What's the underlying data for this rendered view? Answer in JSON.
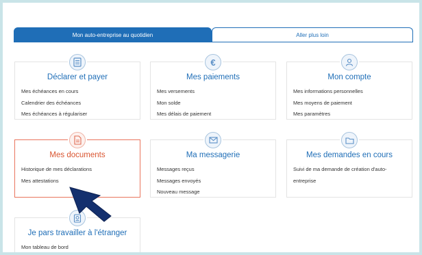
{
  "tabs": [
    {
      "label": "Mon auto-entreprise au quotidien",
      "active": true
    },
    {
      "label": "Aller plus loin",
      "active": false
    }
  ],
  "cards": [
    {
      "title": "Déclarer et payer",
      "icon": "document-list-icon",
      "links": [
        "Mes échéances en cours",
        "Calendrier des échéances",
        "Mes échéances à régulariser"
      ]
    },
    {
      "title": "Mes paiements",
      "icon": "euro-icon",
      "links": [
        "Mes versements",
        "Mon solde",
        "Mes délais de paiement"
      ]
    },
    {
      "title": "Mon compte",
      "icon": "user-icon",
      "links": [
        "Mes informations personnelles",
        "Mes moyens de paiement",
        "Mes paramètres"
      ]
    },
    {
      "title": "Mes documents",
      "icon": "document-icon",
      "selected": true,
      "links": [
        "Historique de mes déclarations",
        "Mes attestations"
      ]
    },
    {
      "title": "Ma messagerie",
      "icon": "envelope-icon",
      "links": [
        "Messages reçus",
        "Messages envoyés",
        "Nouveau message"
      ]
    },
    {
      "title": "Mes demandes en cours",
      "icon": "folder-icon",
      "links": [
        "Suivi de ma demande de création d'auto-",
        "entreprise"
      ]
    },
    {
      "title": "Je pars travailler à l'étranger",
      "icon": "passport-icon",
      "links": [
        "Mon tableau de bord"
      ]
    }
  ],
  "colors": {
    "accent": "#1f6eb7",
    "selected": "#d9542f",
    "cursor": "#14306e"
  }
}
